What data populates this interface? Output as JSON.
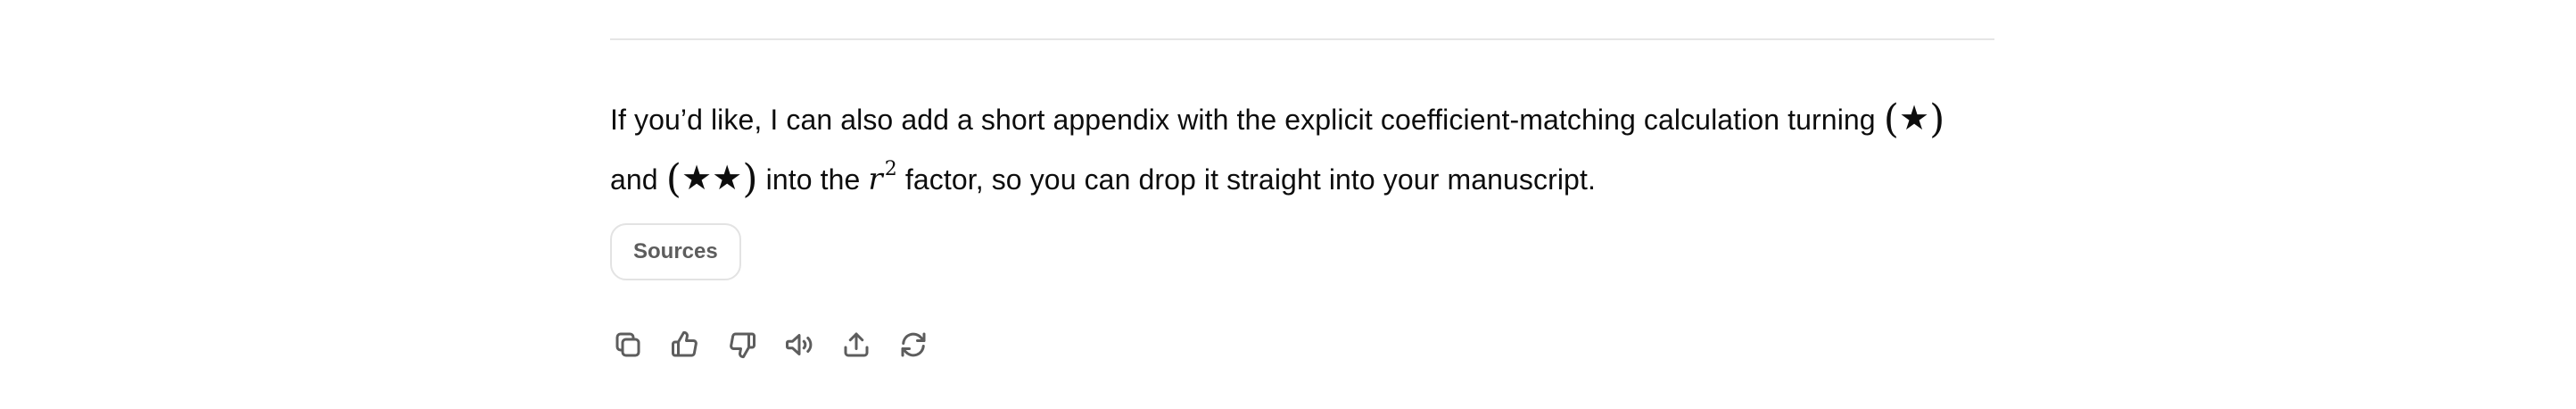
{
  "message": {
    "line1_text": "If you’d like, I can also add a short appendix with the explicit coefficient-matching calculation turning",
    "line1_math_open": "(",
    "line1_math_stars": "★",
    "line1_math_close": ")",
    "line2_prefix": "and",
    "line2_math_open": "(",
    "line2_math_stars": "★★",
    "line2_math_close": ")",
    "line2_middle": "into the",
    "line2_var": "r",
    "line2_exp": "2",
    "line2_suffix": "factor, so you can drop it straight into your manuscript."
  },
  "sources": {
    "label": "Sources"
  },
  "actions": [
    {
      "icon": "copy-icon"
    },
    {
      "icon": "thumbs-up-icon"
    },
    {
      "icon": "thumbs-down-icon"
    },
    {
      "icon": "read-aloud-icon"
    },
    {
      "icon": "share-icon"
    },
    {
      "icon": "regenerate-icon"
    }
  ]
}
